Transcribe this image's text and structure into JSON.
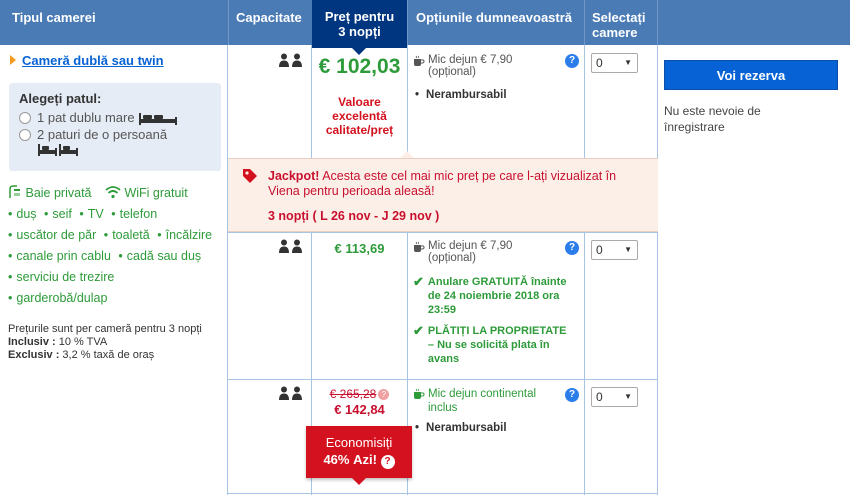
{
  "header": {
    "room_type": "Tipul camerei",
    "capacity": "Capacitate",
    "price_line1": "Preț pentru",
    "price_line2": "3 nopți",
    "options": "Opțiunile dumneavoastră",
    "select_line1": "Selectați",
    "select_line2": "camere"
  },
  "room": {
    "name": "Cameră dublă sau twin",
    "bed_title": "Alegeți patul:",
    "bed_option_1": "1 pat dublu mare",
    "bed_option_2": "2 paturi de o persoană",
    "facilities": {
      "private_bath": "Baie privată",
      "wifi": "WiFi gratuit",
      "items": [
        "duș",
        "seif",
        "TV",
        "telefon",
        "uscător de păr",
        "toaletă",
        "încălzire",
        "canale prin cablu",
        "cadă sau duș",
        "serviciu de trezire",
        "garderobă/dulap"
      ]
    },
    "price_note": "Prețurile sunt per cameră pentru 3 nopți",
    "inclusive_label": "Inclusiv :",
    "inclusive_value": "10 % TVA",
    "exclusive_label": "Exclusiv :",
    "exclusive_value": "3,2 % taxă de oraș"
  },
  "rows": [
    {
      "price": "€ 102,03",
      "value_label": "Valoare excelentă calitate/preț",
      "breakfast": "Mic dejun € 7,90",
      "breakfast_note": "(opțional)",
      "policy": "Nerambursabil",
      "quantity": "0"
    },
    {
      "price": "€ 113,69",
      "breakfast": "Mic dejun € 7,90",
      "breakfast_note": "(opțional)",
      "cancel_text": "Anulare GRATUITĂ înainte de 24 noiembrie 2018 ora 23:59",
      "pay_text": "PLĂTIȚI LA PROPRIETATE – Nu se solicită plata în avans",
      "quantity": "0"
    },
    {
      "old_price": "€ 265,28",
      "price": "€ 142,84",
      "savings_label": "Economisiți",
      "savings_percent": "46%",
      "savings_suffix": "Azi!",
      "breakfast": "Mic dejun continental inclus",
      "policy": "Nerambursabil",
      "quantity": "0"
    }
  ],
  "jackpot": {
    "label": "Jackpot!",
    "message": "Acesta este cel mai mic preț pe care l-ați vizualizat în Viena pentru perioada aleasă!",
    "dates": "3 nopți ( L 26 nov - J 29 nov )"
  },
  "reserve": {
    "button": "Voi rezerva",
    "note": "Nu este nevoie de înregistrare"
  },
  "colors": {
    "header_bg": "#4a7bb5",
    "price_header_bg": "#003580",
    "green": "#2e9b3a",
    "red": "#d4111e",
    "button": "#0762d6"
  }
}
